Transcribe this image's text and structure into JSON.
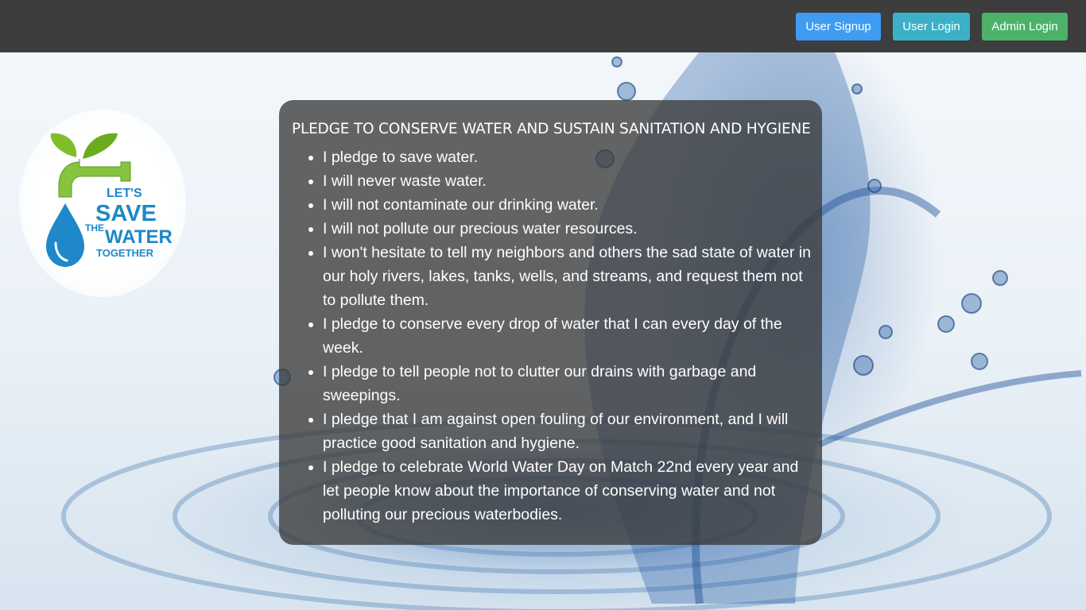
{
  "nav": {
    "buttons": [
      {
        "label": "User Signup",
        "color": "#3f9cf3"
      },
      {
        "label": "User Login",
        "color": "#3bb0c7"
      },
      {
        "label": "Admin Login",
        "color": "#4cb26a"
      }
    ]
  },
  "logo": {
    "text_lines": [
      "LET'S",
      "SAVE",
      "THE",
      "WATER",
      "TOGETHER"
    ]
  },
  "pledge": {
    "title": "PLEDGE TO CONSERVE WATER AND SUSTAIN SANITATION AND HYGIENE",
    "items": [
      "I pledge to save water.",
      "I will never waste water.",
      "I will not contaminate our drinking water.",
      "I will not pollute our precious water resources.",
      "I won't hesitate to tell my neighbors and others the sad state of water in our holy rivers, lakes, tanks, wells, and streams, and request them not to pollute them.",
      "I pledge to conserve every drop of water that I can every day of the week.",
      "I pledge to tell people not to clutter our drains with garbage and sweepings.",
      "I pledge that I am against open fouling of our environment, and I will practice good sanitation and hygiene.",
      "I pledge to celebrate World Water Day on Match 22nd every year and let people know about the importance of conserving water and not polluting our precious waterbodies."
    ]
  },
  "colors": {
    "navbar": "#3d3d3d",
    "panel": "rgba(58,58,58,0.78)",
    "leaf_green": "#7fbf2a",
    "water_blue": "#1e88c8"
  }
}
